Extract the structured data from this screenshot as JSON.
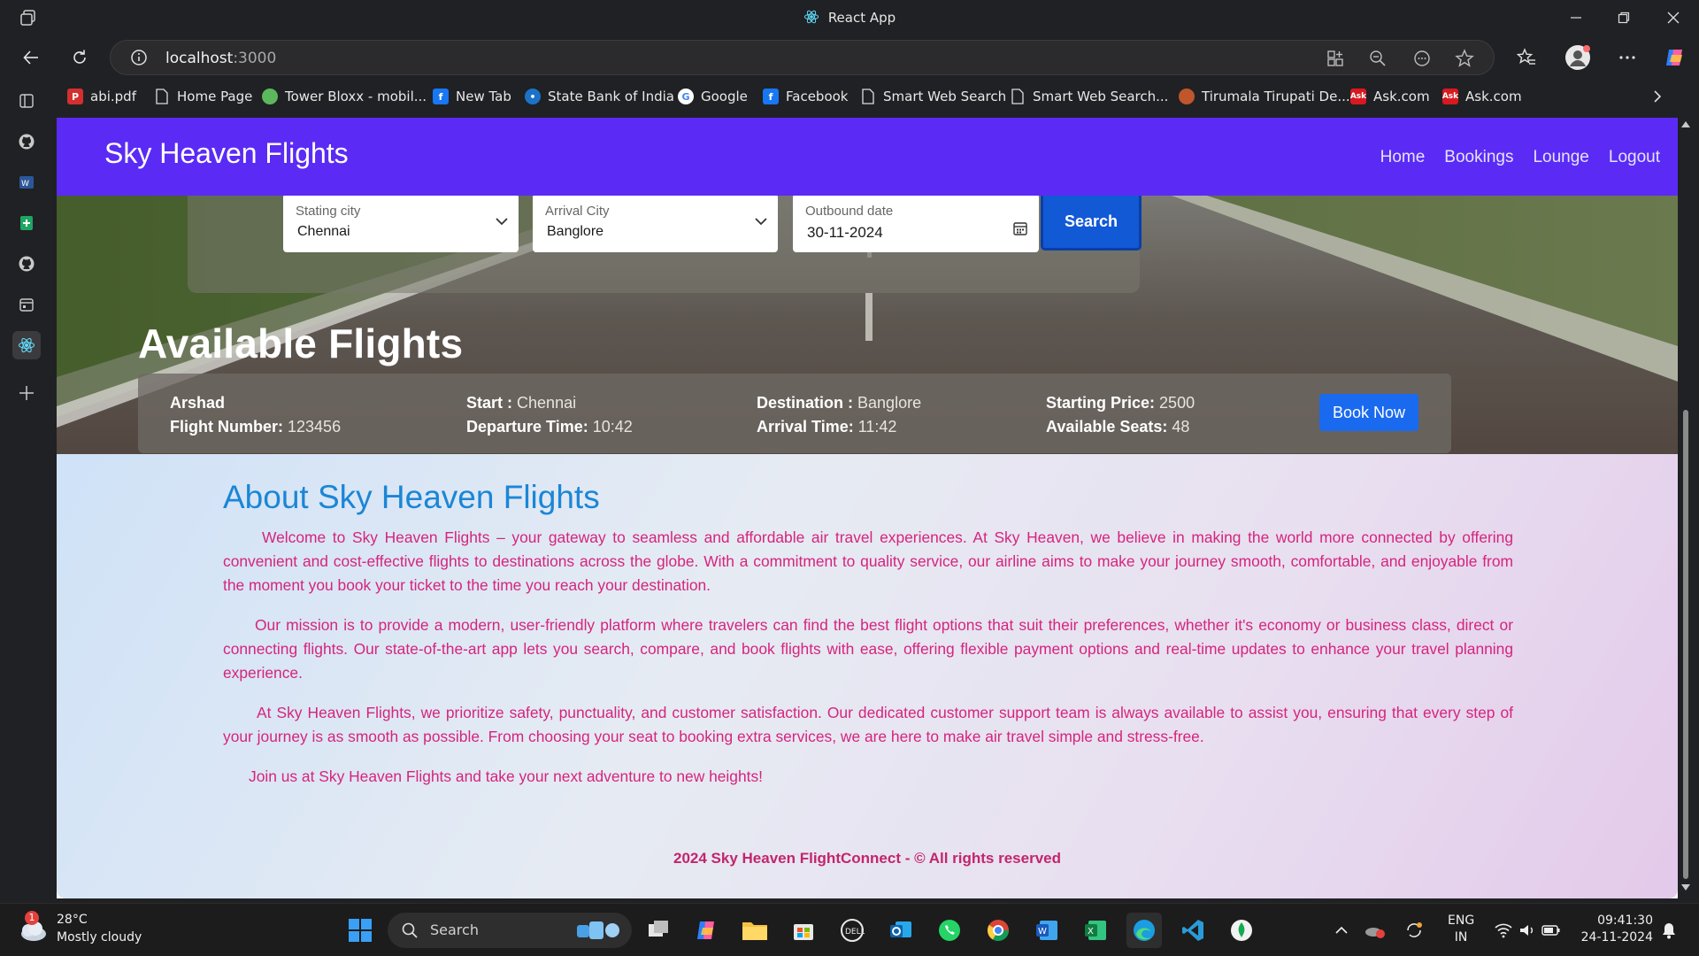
{
  "window": {
    "title": "React App"
  },
  "address_bar": {
    "host": "localhost",
    "port": ":3000"
  },
  "bookmarks": [
    {
      "label": "abi.pdf",
      "icon": "pdf-icon",
      "color": "#d32f2f"
    },
    {
      "label": "Home Page",
      "icon": "page-icon",
      "color": "#202124"
    },
    {
      "label": "Tower Bloxx - mobil...",
      "icon": "game-icon",
      "color": "#5cb85c"
    },
    {
      "label": "New Tab",
      "icon": "facebook-icon",
      "color": "#1877f2"
    },
    {
      "label": "State Bank of India",
      "icon": "sbi-icon",
      "color": "#1a73c8"
    },
    {
      "label": "Google",
      "icon": "google-icon",
      "color": "#ffffff"
    },
    {
      "label": "Facebook",
      "icon": "facebook-icon",
      "color": "#1877f2"
    },
    {
      "label": "Smart Web Search",
      "icon": "page-icon",
      "color": "#202124"
    },
    {
      "label": "Smart Web Search...",
      "icon": "page-icon",
      "color": "#202124"
    },
    {
      "label": "Tirumala Tirupati De...",
      "icon": "ttd-icon",
      "color": "#c0562b"
    },
    {
      "label": "Ask.com",
      "icon": "ask-icon",
      "color": "#d71920"
    },
    {
      "label": "Ask.com",
      "icon": "ask-icon",
      "color": "#d71920"
    }
  ],
  "app": {
    "brand": "Sky Heaven Flights",
    "nav_links": [
      "Home",
      "Bookings",
      "Lounge",
      "Logout"
    ],
    "search": {
      "from_label": "Stating city",
      "from_value": "Chennai",
      "to_label": "Arrival City",
      "to_value": "Banglore",
      "date_label": "Outbound date",
      "date_value": "30-11-2024",
      "button": "Search"
    },
    "flights_heading": "Available Flights",
    "flight": {
      "name": "Arshad",
      "flight_number_label": "Flight Number:",
      "flight_number": "123456",
      "start_label": "Start :",
      "start": "Chennai",
      "departure_label": "Departure Time:",
      "departure": "10:42",
      "destination_label": "Destination :",
      "destination": "Banglore",
      "arrival_label": "Arrival Time:",
      "arrival": "11:42",
      "price_label": "Starting Price:",
      "price": "2500",
      "seats_label": "Available Seats:",
      "seats": "48",
      "book_button": "Book Now"
    },
    "about": {
      "heading": "About Sky Heaven Flights",
      "paragraphs": [
        "Welcome to Sky Heaven Flights – your gateway to seamless and affordable air travel experiences. At Sky Heaven, we believe in making the world more connected by offering convenient and cost-effective flights to destinations across the globe. With a commitment to quality service, our airline aims to make your journey smooth, comfortable, and enjoyable from the moment you book your ticket to the time you reach your destination.",
        "Our mission is to provide a modern, user-friendly platform where travelers can find the best flight options that suit their preferences, whether it's economy or business class, direct or connecting flights. Our state-of-the-art app lets you search, compare, and book flights with ease, offering flexible payment options and real-time updates to enhance your travel planning experience.",
        "At Sky Heaven Flights, we prioritize safety, punctuality, and customer satisfaction. Our dedicated customer support team is always available to assist you, ensuring that every step of your journey is as smooth as possible. From choosing your seat to booking extra services, we are here to make air travel simple and stress-free.",
        "Join us at Sky Heaven Flights and take your next adventure to new heights!"
      ],
      "footer": "2024 Sky Heaven FlightConnect - © All rights reserved"
    }
  },
  "taskbar": {
    "weather_temp": "28°C",
    "weather_desc": "Mostly cloudy",
    "weather_badge": "1",
    "search_label": "Search",
    "lang_top": "ENG",
    "lang_bottom": "IN",
    "time": "09:41:30",
    "date": "24-11-2024"
  },
  "colors": {
    "app_nav": "#5b2bf5",
    "search_button": "#1259d6",
    "book_button": "#1a6af0",
    "about_heading": "#1b86d6",
    "about_text": "#d6247e"
  }
}
